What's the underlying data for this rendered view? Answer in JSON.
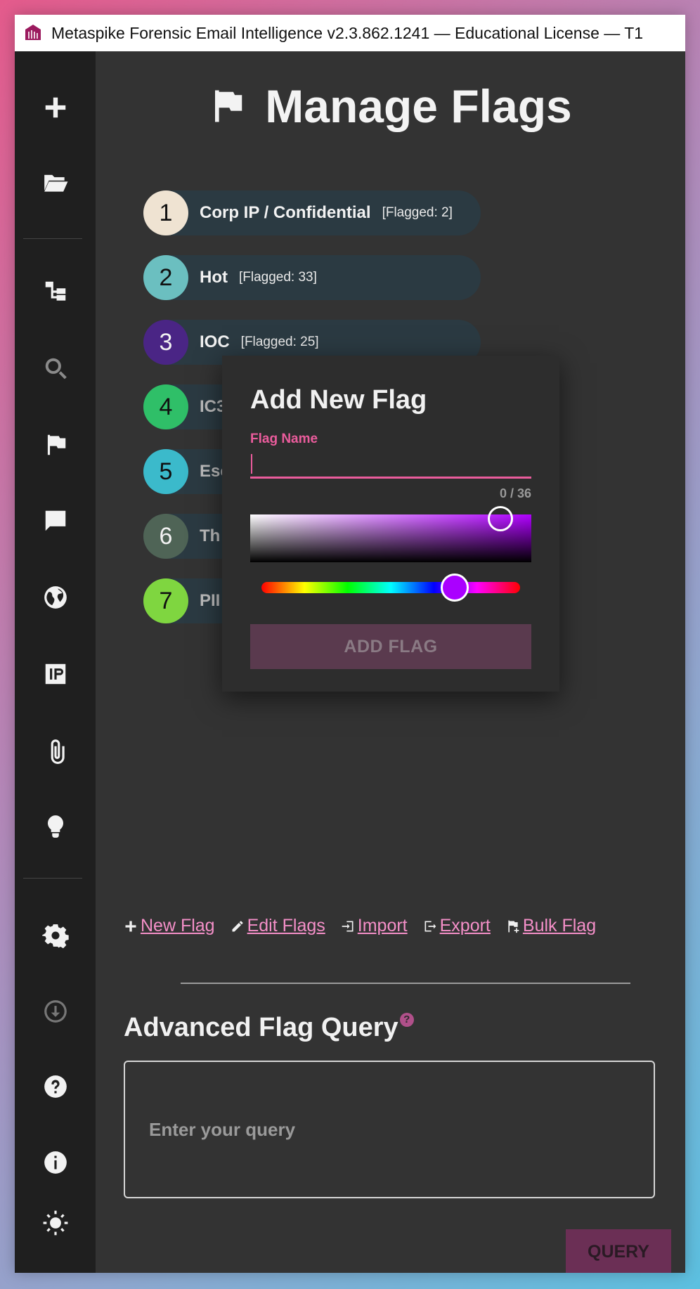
{
  "window": {
    "title": "Metaspike Forensic Email Intelligence v2.3.862.1241 — Educational License — T1"
  },
  "sidebar": {
    "items": [
      {
        "icon": "plus-icon"
      },
      {
        "icon": "folder-open-icon"
      },
      {
        "icon": "tree-icon"
      },
      {
        "icon": "search-icon"
      },
      {
        "icon": "flag-icon"
      },
      {
        "icon": "chat-icon"
      },
      {
        "icon": "globe-icon"
      },
      {
        "icon": "ip-icon"
      },
      {
        "icon": "paperclip-icon"
      },
      {
        "icon": "lightbulb-icon"
      },
      {
        "icon": "gear-icon"
      },
      {
        "icon": "download-icon"
      },
      {
        "icon": "help-icon"
      },
      {
        "icon": "info-icon"
      },
      {
        "icon": "brightness-icon"
      }
    ]
  },
  "page": {
    "title": "Manage Flags"
  },
  "flags": [
    {
      "num": "1",
      "name": "Corp IP / Confidential",
      "count": "[Flagged: 2]",
      "color": "#efe3d2"
    },
    {
      "num": "2",
      "name": "Hot",
      "count": "[Flagged: 33]",
      "color": "#6bbfc0"
    },
    {
      "num": "3",
      "name": "IOC",
      "count": "[Flagged: 25]",
      "color": "#4a2585"
    },
    {
      "num": "4",
      "name": "IC3",
      "count": "",
      "color": "#2fbf68"
    },
    {
      "num": "5",
      "name": "Esc",
      "count": "",
      "color": "#3bbacb"
    },
    {
      "num": "6",
      "name": "Th",
      "count": "",
      "color": "#4f6456"
    },
    {
      "num": "7",
      "name": "PII",
      "count": "",
      "color": "#7fd640"
    }
  ],
  "dialog": {
    "title": "Add New Flag",
    "field_label": "Flag Name",
    "value": "",
    "counter": "0 / 36",
    "selected_color": "#aa00ff",
    "add_button": "ADD FLAG"
  },
  "actions": {
    "new_flag": "New Flag",
    "edit_flags": "Edit Flags",
    "import": "Import",
    "export": "Export",
    "bulk_flag": "Bulk Flag"
  },
  "advanced": {
    "title": "Advanced Flag Query",
    "help": "?",
    "placeholder": "Enter your query",
    "query_button": "QUERY"
  }
}
